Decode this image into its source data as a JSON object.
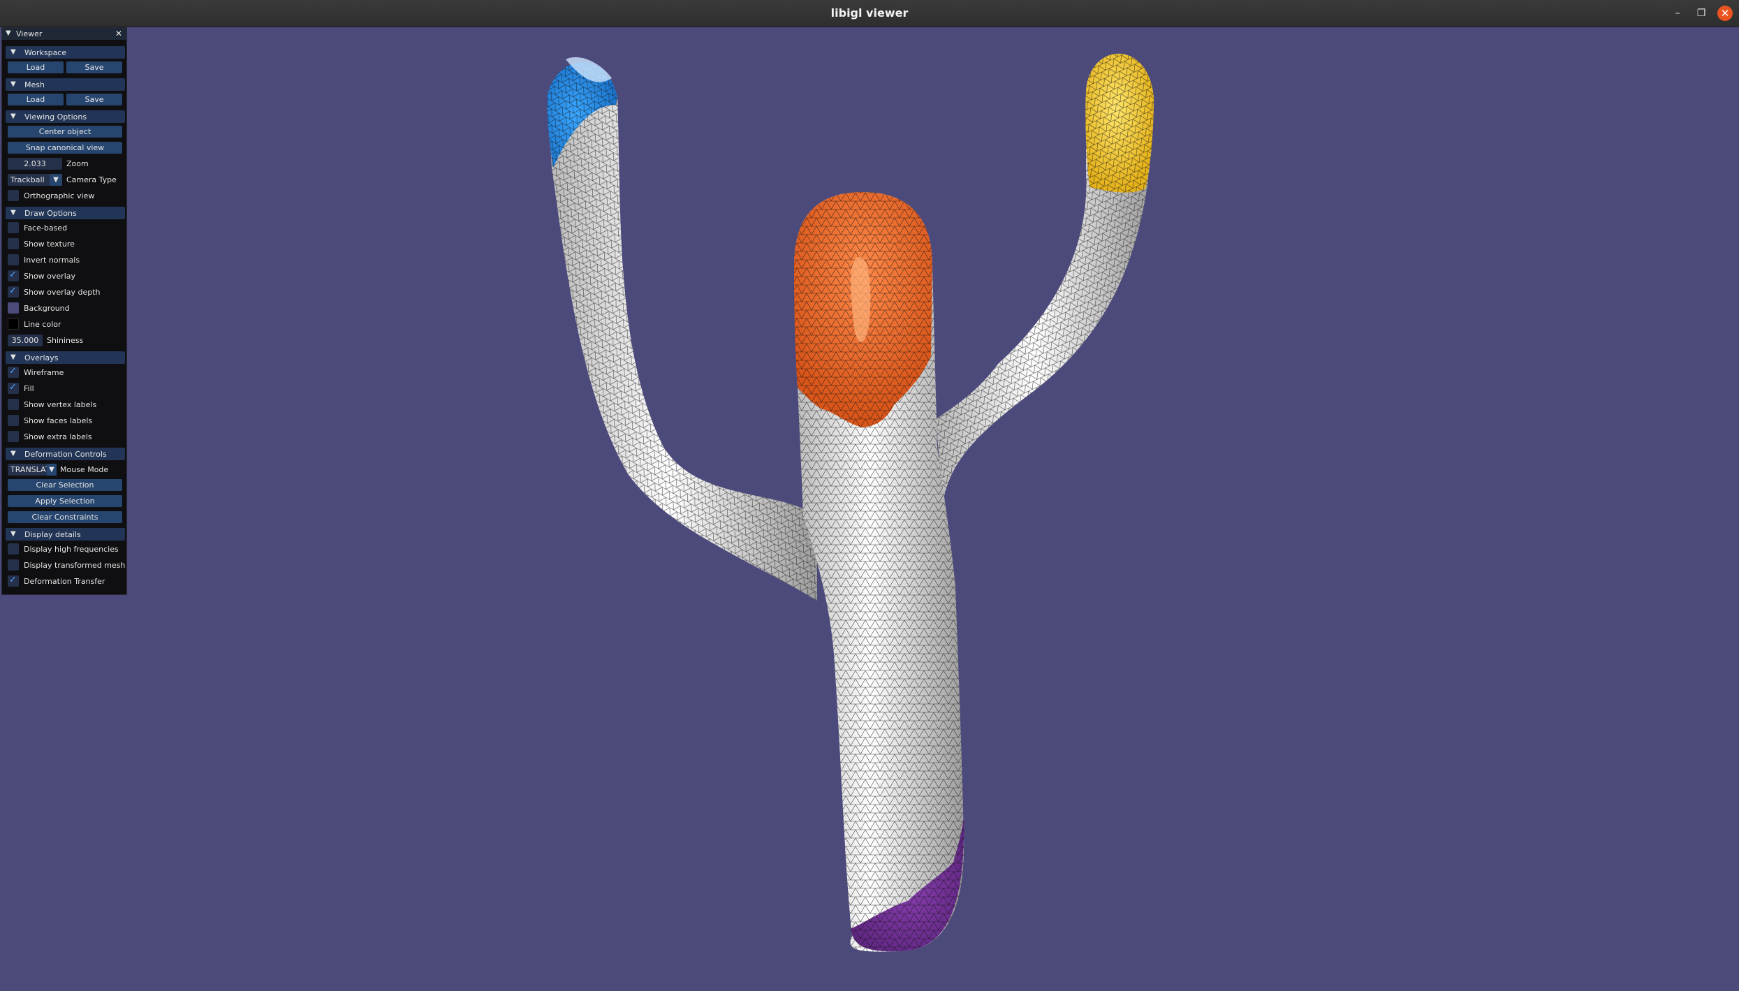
{
  "window": {
    "title": "libigl viewer"
  },
  "colors": {
    "background": "#4c4a7a",
    "panel": "#0f0f11",
    "header": "#223556",
    "button": "#27466f",
    "check": "#4fa3ff",
    "close": "#e95420",
    "line_color": "#000000"
  },
  "panel": {
    "title": "Viewer",
    "workspace": {
      "header": "Workspace",
      "load": "Load",
      "save": "Save"
    },
    "mesh": {
      "header": "Mesh",
      "load": "Load",
      "save": "Save"
    },
    "viewing": {
      "header": "Viewing Options",
      "center": "Center object",
      "snap": "Snap canonical view",
      "zoom_value": "2.033",
      "zoom_label": "Zoom",
      "camera_value": "Trackball",
      "camera_label": "Camera Type",
      "ortho_label": "Orthographic view",
      "ortho_checked": false
    },
    "draw": {
      "header": "Draw Options",
      "face_based": "Face-based",
      "face_based_checked": false,
      "show_texture": "Show texture",
      "show_texture_checked": false,
      "invert_normals": "Invert normals",
      "invert_normals_checked": false,
      "show_overlay": "Show overlay",
      "show_overlay_checked": true,
      "show_overlay_depth": "Show overlay depth",
      "show_overlay_depth_checked": true,
      "background": "Background",
      "line_color": "Line color",
      "shininess_value": "35.000",
      "shininess_label": "Shininess"
    },
    "overlays": {
      "header": "Overlays",
      "wireframe": "Wireframe",
      "wireframe_checked": true,
      "fill": "Fill",
      "fill_checked": true,
      "vertex_labels": "Show vertex labels",
      "vertex_labels_checked": false,
      "faces_labels": "Show faces labels",
      "faces_labels_checked": false,
      "extra_labels": "Show extra labels",
      "extra_labels_checked": false
    },
    "deformation": {
      "header": "Deformation Controls",
      "mouse_mode_value": "TRANSLAT",
      "mouse_mode_label": "Mouse Mode",
      "clear_selection": "Clear Selection",
      "apply_selection": "Apply Selection",
      "clear_constraints": "Clear Constraints"
    },
    "display": {
      "header": "Display details",
      "high_freq": "Display high frequencies",
      "high_freq_checked": false,
      "transformed": "Display transformed mesh",
      "transformed_checked": false,
      "transfer": "Deformation Transfer",
      "transfer_checked": true
    }
  }
}
